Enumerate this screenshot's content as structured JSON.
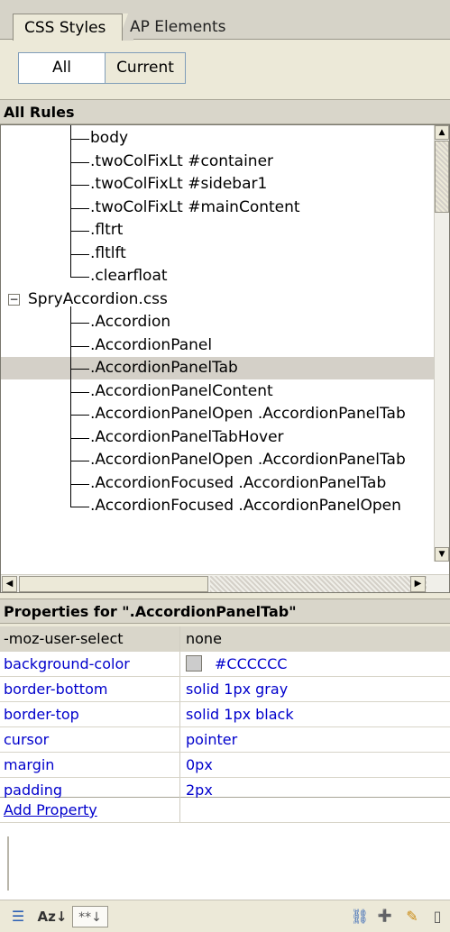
{
  "tabs": [
    {
      "label": "CSS Styles",
      "active": true
    },
    {
      "label": "AP Elements",
      "active": false
    }
  ],
  "mode_buttons": {
    "all": "All",
    "current": "Current"
  },
  "all_rules": {
    "title": "All Rules",
    "items": [
      {
        "label": "body"
      },
      {
        "label": ".twoColFixLt #container"
      },
      {
        "label": ".twoColFixLt #sidebar1"
      },
      {
        "label": ".twoColFixLt #mainContent"
      },
      {
        "label": ".fltrt"
      },
      {
        "label": ".fltlft"
      },
      {
        "label": ".clearfloat"
      },
      {
        "label": "SpryAccordion.css",
        "expander": "−"
      },
      {
        "label": ".Accordion"
      },
      {
        "label": ".AccordionPanel"
      },
      {
        "label": ".AccordionPanelTab",
        "selected": true
      },
      {
        "label": ".AccordionPanelContent"
      },
      {
        "label": ".AccordionPanelOpen .AccordionPanelTab"
      },
      {
        "label": ".AccordionPanelTabHover"
      },
      {
        "label": ".AccordionPanelOpen .AccordionPanelTab"
      },
      {
        "label": ".AccordionFocused .AccordionPanelTab"
      },
      {
        "label": ".AccordionFocused .AccordionPanelOpen"
      }
    ]
  },
  "properties": {
    "title": "Properties for \".AccordionPanelTab\"",
    "rows": [
      {
        "name": "-moz-user-select",
        "value": "none"
      },
      {
        "name": "background-color",
        "value": "#CCCCCC",
        "swatch": "#cccccc"
      },
      {
        "name": "border-bottom",
        "value": "solid 1px gray"
      },
      {
        "name": "border-top",
        "value": "solid 1px black"
      },
      {
        "name": "cursor",
        "value": "pointer"
      },
      {
        "name": "margin",
        "value": "0px"
      },
      {
        "name": "padding",
        "value": "2px"
      }
    ],
    "add_property": "Add Property"
  },
  "toolbar": {
    "left_icons": [
      "category-view-icon",
      "alphabetical-sort-icon",
      "set-properties-icon"
    ],
    "right_icons": [
      "attach-stylesheet-icon",
      "new-rule-icon",
      "edit-rule-icon",
      "delete-rule-icon"
    ],
    "glyphs": {
      "category": "☰",
      "alpha": "Az↓",
      "set": "**↓",
      "attach": "⛓",
      "new": "➕",
      "edit": "✎",
      "delete": "▯"
    }
  },
  "colors": {
    "link": "#0000cc",
    "selected_row": "#d4d0c8",
    "panel": "#ece9d8"
  }
}
